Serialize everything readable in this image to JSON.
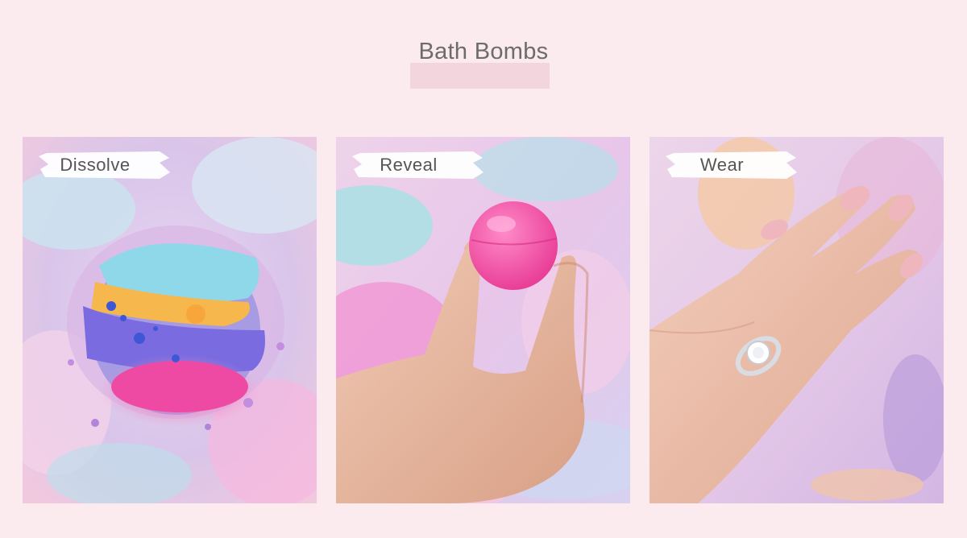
{
  "section": {
    "title": "Bath Bombs"
  },
  "cards": [
    {
      "label": "Dissolve",
      "image": "bath-bomb-dissolving-in-water"
    },
    {
      "label": "Reveal",
      "image": "hand-holding-pink-ball"
    },
    {
      "label": "Wear",
      "image": "hand-wearing-diamond-ring"
    }
  ],
  "colors": {
    "background": "#fbeaee",
    "title_highlight": "#f3d5dd",
    "title_text": "#6c6c6c",
    "label_text": "#555555"
  }
}
